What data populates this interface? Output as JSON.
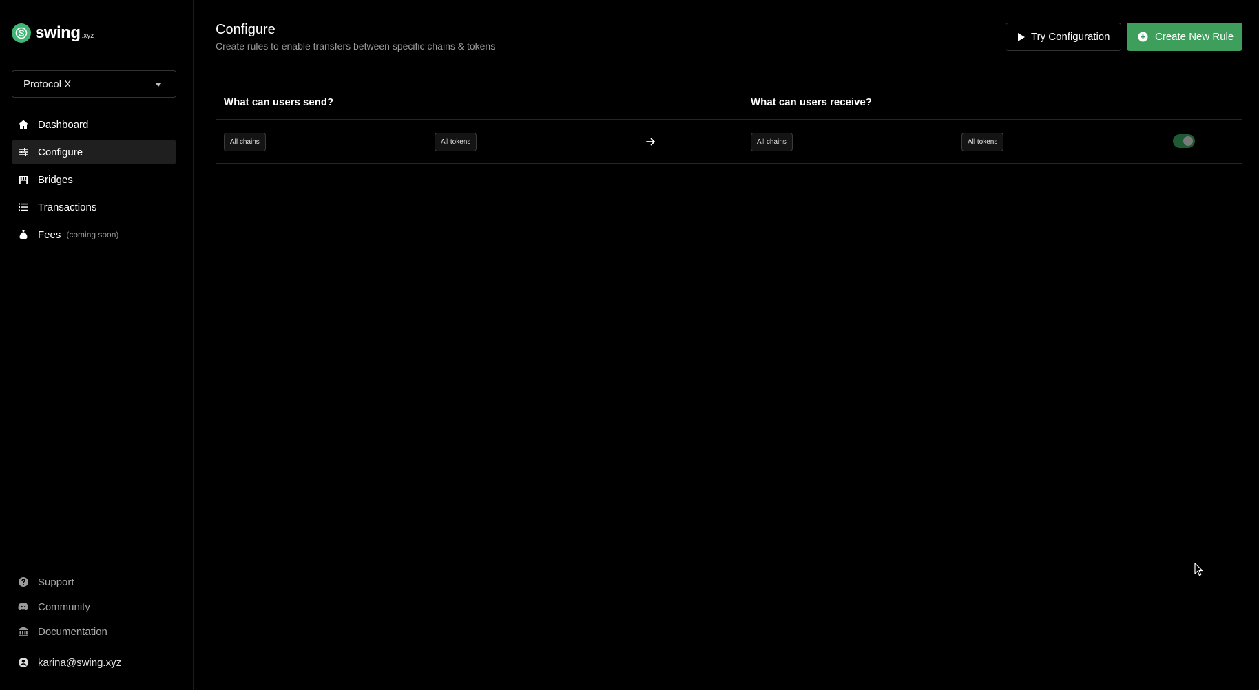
{
  "brand": {
    "name": "swing",
    "suffix": ".xyz",
    "accent": "#3fb673"
  },
  "project_selector": {
    "selected": "Protocol X"
  },
  "nav": {
    "items": [
      {
        "label": "Dashboard",
        "icon": "home-icon",
        "note": ""
      },
      {
        "label": "Configure",
        "icon": "sliders-icon",
        "note": "",
        "active": true
      },
      {
        "label": "Bridges",
        "icon": "bridge-icon",
        "note": ""
      },
      {
        "label": "Transactions",
        "icon": "list-icon",
        "note": ""
      },
      {
        "label": "Fees",
        "icon": "money-bag-icon",
        "note": "(coming soon)"
      }
    ]
  },
  "footer_nav": {
    "items": [
      {
        "label": "Support",
        "icon": "help-icon"
      },
      {
        "label": "Community",
        "icon": "discord-icon"
      },
      {
        "label": "Documentation",
        "icon": "bank-icon"
      }
    ],
    "user": "karina@swing.xyz"
  },
  "page": {
    "title": "Configure",
    "subtitle": "Create rules to enable transfers between specific chains & tokens"
  },
  "actions": {
    "try_label": "Try Configuration",
    "create_label": "Create New Rule",
    "create_color": "#3e9e5c"
  },
  "rules": {
    "send_header": "What can users send?",
    "receive_header": "What can users receive?",
    "row": {
      "send_chains": "All chains",
      "send_tokens": "All tokens",
      "receive_chains": "All chains",
      "receive_tokens": "All tokens",
      "enabled": true
    }
  }
}
